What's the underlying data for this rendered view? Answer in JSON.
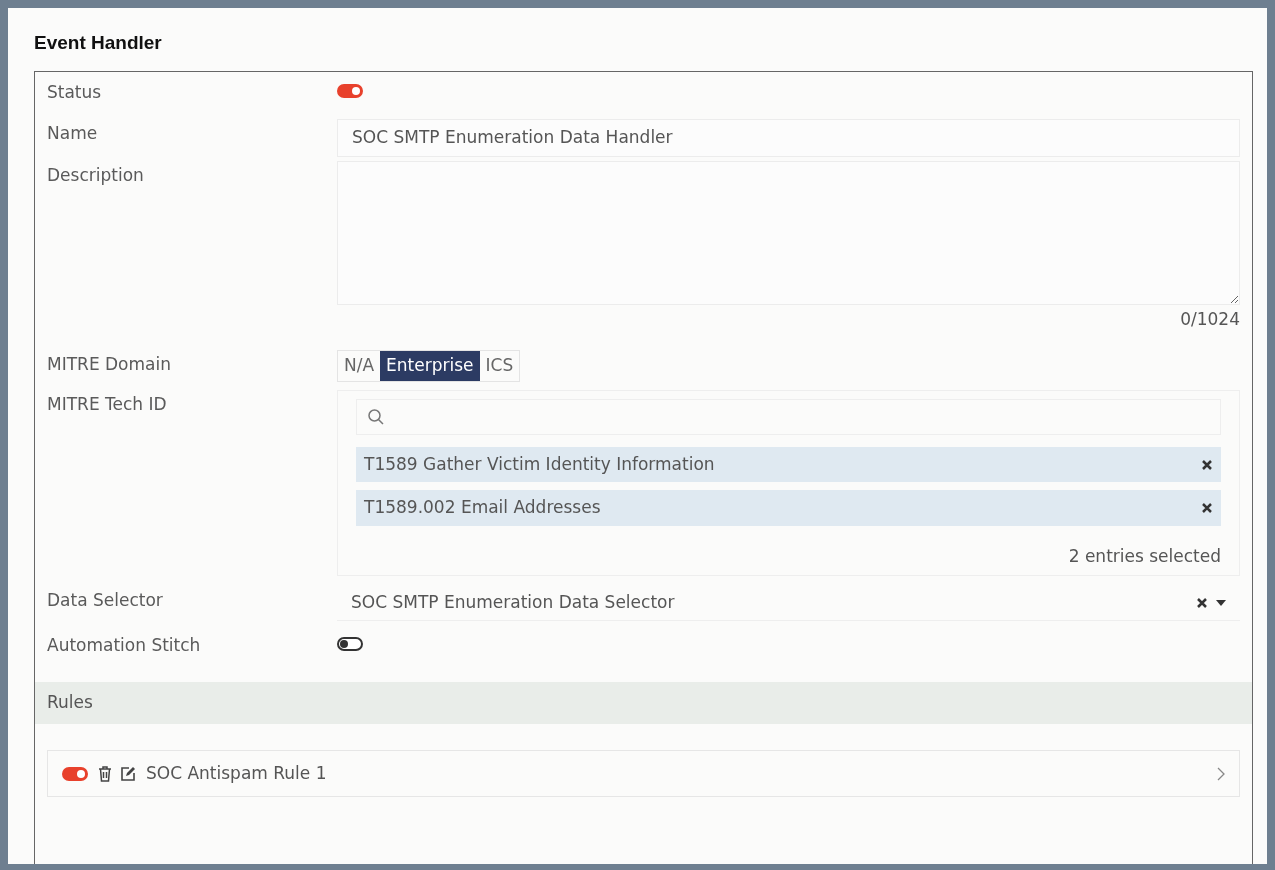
{
  "title": "Event Handler",
  "status": {
    "label": "Status",
    "on": true
  },
  "name": {
    "label": "Name",
    "value": "SOC SMTP Enumeration Data Handler"
  },
  "description": {
    "label": "Description",
    "counter": "0/1024"
  },
  "mitre_domain": {
    "label": "MITRE Domain",
    "options": [
      {
        "label": "N/A",
        "selected": false
      },
      {
        "label": "Enterprise",
        "selected": true
      },
      {
        "label": "ICS",
        "selected": false
      }
    ]
  },
  "mitre_tech_id": {
    "label": "MITRE Tech ID",
    "entries": [
      {
        "text": "T1589 Gather Victim Identity Information"
      },
      {
        "text": "T1589.002 Email Addresses"
      }
    ],
    "summary": "2 entries selected"
  },
  "data_selector": {
    "label": "Data Selector",
    "value": "SOC SMTP Enumeration Data Selector"
  },
  "automation_stitch": {
    "label": "Automation Stitch",
    "on": false
  },
  "rules": {
    "heading": "Rules",
    "items": [
      {
        "name": "SOC Antispam Rule 1",
        "on": true
      }
    ]
  }
}
